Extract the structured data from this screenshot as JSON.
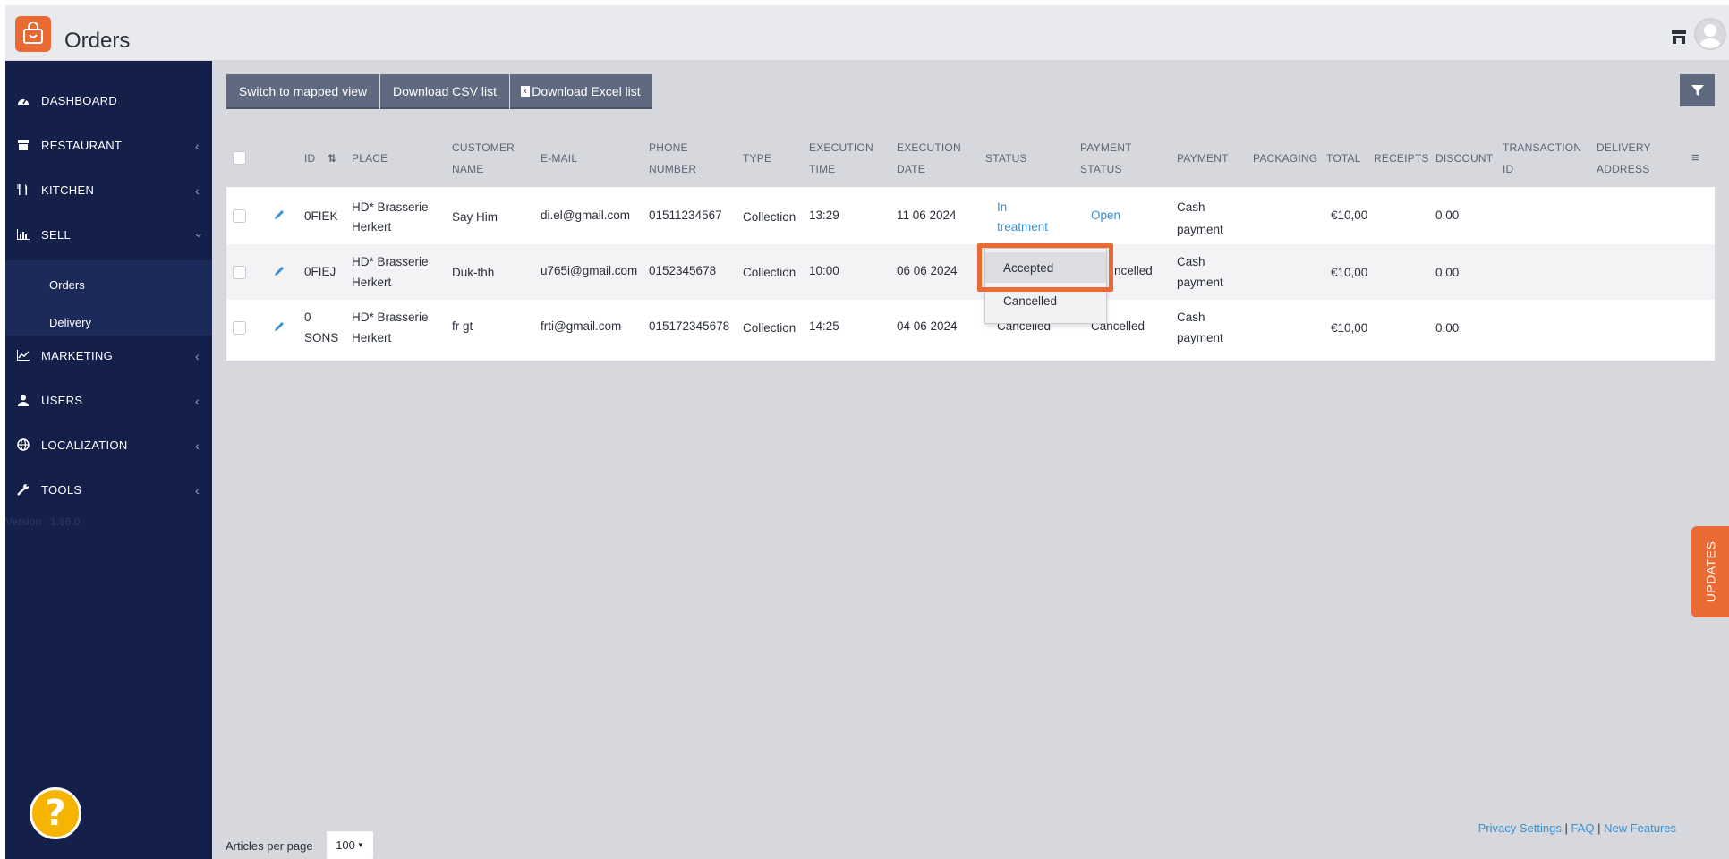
{
  "app": {
    "title": "Orders"
  },
  "sidebar": {
    "items": [
      {
        "label": "DASHBOARD",
        "icon": "dashboard-icon"
      },
      {
        "label": "RESTAURANT",
        "icon": "store-icon"
      },
      {
        "label": "KITCHEN",
        "icon": "cutlery-icon"
      },
      {
        "label": "SELL",
        "icon": "bar-chart-icon"
      },
      {
        "label": "MARKETING",
        "icon": "line-chart-icon"
      },
      {
        "label": "USERS",
        "icon": "user-icon"
      },
      {
        "label": "LOCALIZATION",
        "icon": "globe-icon"
      },
      {
        "label": "TOOLS",
        "icon": "wrench-icon"
      }
    ],
    "sub_items": [
      "Orders",
      "Delivery"
    ],
    "version": "Version : 1.86.0"
  },
  "toolbar": {
    "mapped_view": "Switch to mapped view",
    "csv": "Download CSV list",
    "excel": "Download Excel list"
  },
  "table": {
    "headers": {
      "id": "ID",
      "place": "PLACE",
      "customer_name_1": "CUSTOMER",
      "customer_name_2": "NAME",
      "email": "E-MAIL",
      "phone_1": "PHONE",
      "phone_2": "NUMBER",
      "type": "TYPE",
      "exec_time_1": "EXECUTION",
      "exec_time_2": "TIME",
      "exec_date_1": "EXECUTION",
      "exec_date_2": "DATE",
      "status": "STATUS",
      "payment_status_1": "PAYMENT",
      "payment_status_2": "STATUS",
      "payment": "PAYMENT",
      "packaging": "PACKAGING",
      "total": "TOTAL",
      "receipts": "RECEIPTS",
      "discount": "DISCOUNT",
      "transaction_1": "TRANSACTION",
      "transaction_2": "ID",
      "delivery_1": "DELIVERY",
      "delivery_2": "ADDRESS"
    },
    "rows": [
      {
        "id": "0FIEK",
        "place_1": "HD* Brasserie",
        "place_2": "Herkert",
        "customer": "Say Him",
        "email": "di.el@gmail.com",
        "phone": "01511234567",
        "type": "Collection",
        "time": "13:29",
        "date": "11 06 2024",
        "status_1": "In",
        "status_2": "treatment",
        "payment_status": "Open",
        "payment_1": "Cash",
        "payment_2": "payment",
        "total": "€10,00",
        "discount": "0.00"
      },
      {
        "id": "0FIEJ",
        "place_1": "HD* Brasserie",
        "place_2": "Herkert",
        "customer": "Duk-thh",
        "email": "u765i@gmail.com",
        "phone": "0152345678",
        "type": "Collection",
        "time": "10:00",
        "date": "06 06 2024",
        "status_1": "",
        "status_2": "",
        "payment_status": "Cancelled",
        "payment_status_visible": "ncelled",
        "payment_1": "Cash",
        "payment_2": "payment",
        "total": "€10,00",
        "discount": "0.00"
      },
      {
        "id_1": "0",
        "id_2": "SONS",
        "place_1": "HD* Brasserie",
        "place_2": "Herkert",
        "customer": "fr gt",
        "email": "frti@gmail.com",
        "phone": "015172345678",
        "type": "Collection",
        "time": "14:25",
        "date": "04 06 2024",
        "status": "Cancelled",
        "payment_status": "Cancelled",
        "payment_1": "Cash",
        "payment_2": "payment",
        "total": "€10,00",
        "discount": "0.00"
      }
    ]
  },
  "status_dropdown": {
    "options": [
      "Accepted",
      "Cancelled"
    ],
    "selected": "Accepted"
  },
  "footer": {
    "privacy": "Privacy Settings",
    "sep": " | ",
    "faq": "FAQ",
    "new_features": "New Features"
  },
  "pagination": {
    "label": "Articles per page",
    "value": "100"
  },
  "updates_tab": "UPDATES",
  "colors": {
    "brand": "#ea6a34",
    "sidebar": "#15204a",
    "link": "#3b8fcf",
    "help": "#f6b400"
  }
}
